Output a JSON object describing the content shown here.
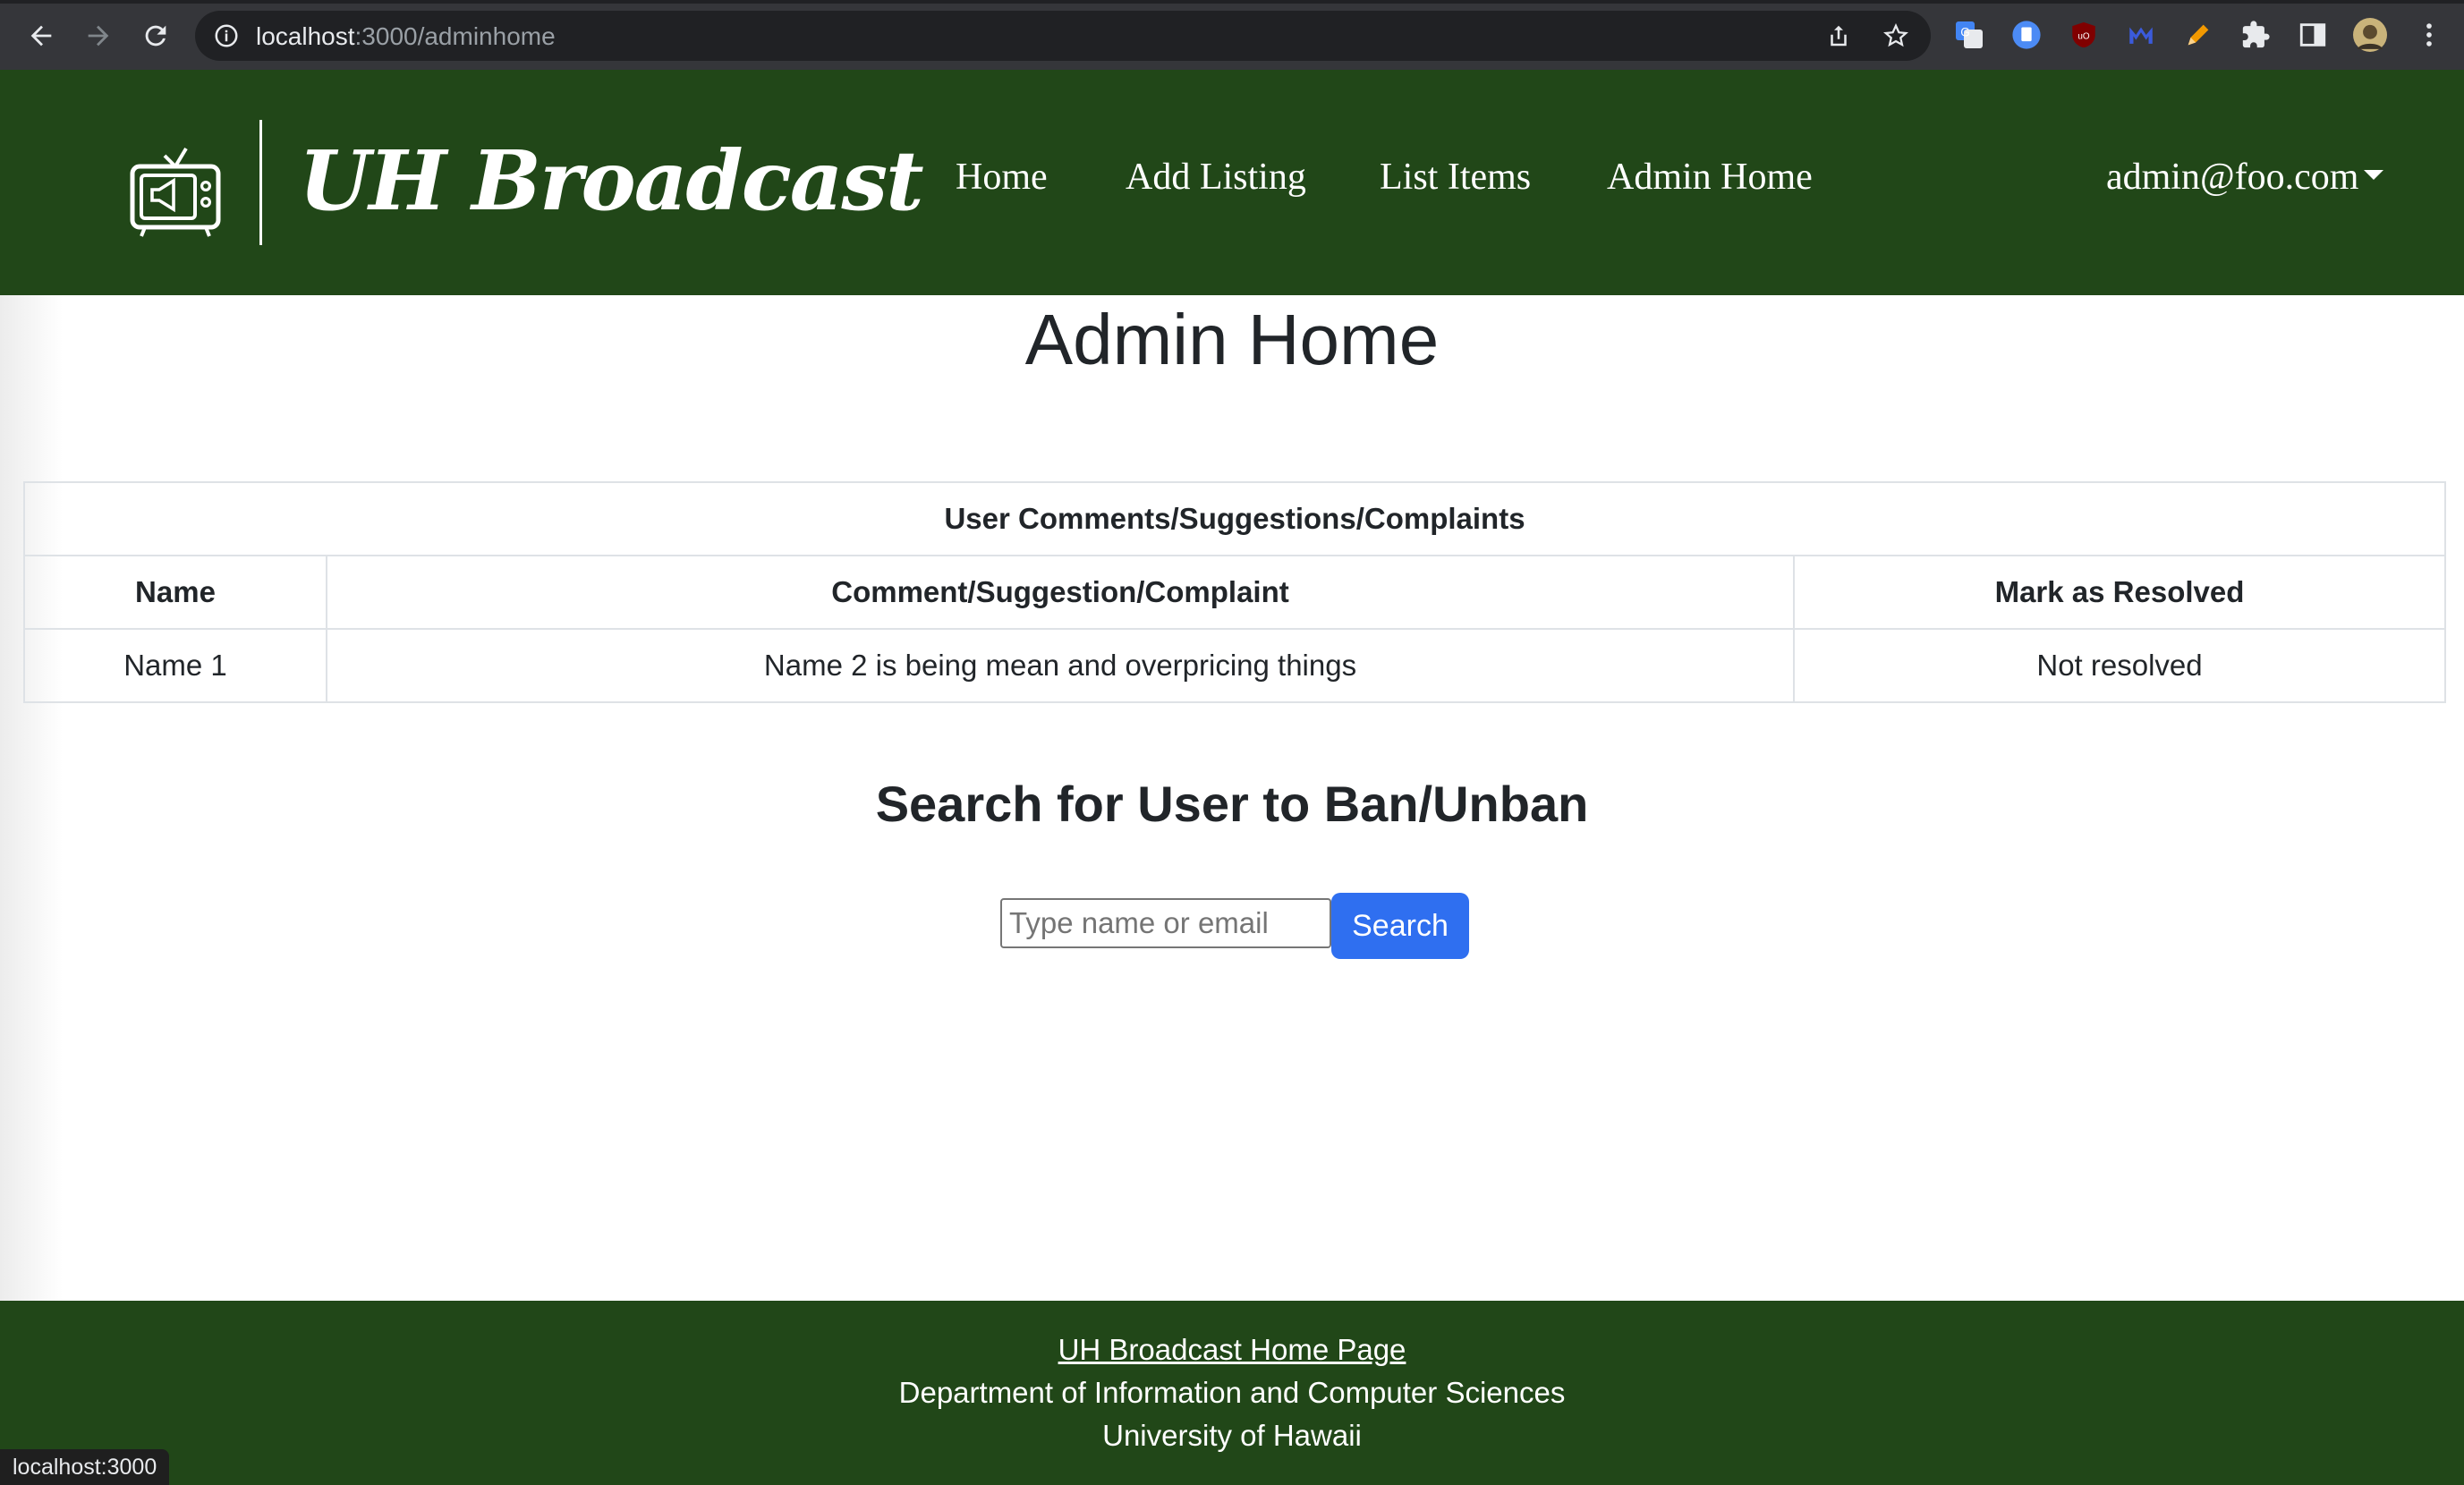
{
  "browser": {
    "url_host": "localhost",
    "url_path": ":3000/adminhome",
    "status_text": "localhost:3000",
    "extension_colors": {
      "translate": "#4285f4",
      "docs": "#4c8bf5",
      "ublock": "#800000",
      "malwarebytes": "#3b5bdb",
      "pencil": "#f29900"
    }
  },
  "navbar": {
    "brand": "UH Broadcast",
    "links": [
      "Home",
      "Add Listing",
      "List Items",
      "Admin Home"
    ],
    "user": "admin@foo.com",
    "bg_color": "#214718"
  },
  "main": {
    "title": "Admin Home",
    "table": {
      "caption": "User Comments/Suggestions/Complaints",
      "headers": [
        "Name",
        "Comment/Suggestion/Complaint",
        "Mark as Resolved"
      ],
      "rows": [
        [
          "Name 1",
          "Name 2 is being mean and overpricing things",
          "Not resolved"
        ]
      ]
    },
    "search": {
      "title": "Search for User to Ban/Unban",
      "placeholder": "Type name or email",
      "button": "Search",
      "button_color": "#2f6ff0"
    }
  },
  "footer": {
    "link": "UH Broadcast Home Page",
    "line2": "Department of Information and Computer Sciences",
    "line3": "University of Hawaii"
  }
}
